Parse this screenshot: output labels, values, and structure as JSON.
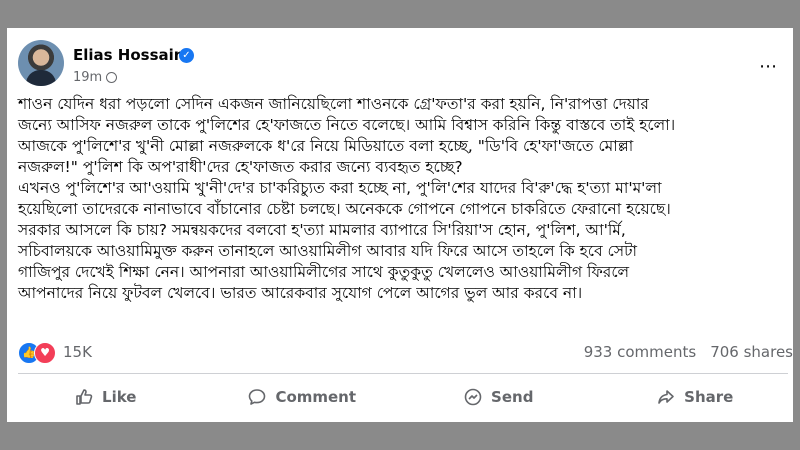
{
  "post": {
    "author": "Elias Hossain",
    "time": "19m",
    "more_icon": "⋯",
    "lines": [
      "শাওন যেদিন ধরা পড়লো সেদিন একজন জানিয়েছিলো শাওনকে গ্রে'ফতা'র করা হয়নি, নি'রাপত্তা দেয়ার",
      "জন্যে আসিফ নজরুল তাকে পু'লিশের হে'ফাজতে নিতে বলেছে। আমি বিশ্বাস করিনি কিন্তু বাস্তবে তাই হলো।",
      "আজকে পু'লিশে'র খু'নী মোল্লা নজরুলকে ধ'রে নিয়ে মিডিয়াতে বলা হচ্ছে, \"ডি'বি হে'ফা'জতে মোল্লা",
      "নজরুল!\" পু'লিশ কি অপ'রাধী'দের হে'ফাজত করার জন্যে ব্যবহৃত হচ্ছে?",
      "এখনও পু'লিশে'র আ'ওয়ামি খু'নী'দে'র চা'করিচ্যুত করা হচ্ছে না, পু'লি'শের যাদের বি'রু'দ্ধে হ'ত্যা মা'ম'লা",
      "হয়েছিলো তাদেরকে নানাভাবে বাঁচানোর চেষ্টা চলছে। অনেককে গোপনে গোপনে চাকরিতে ফেরানো হয়েছে।",
      "সরকার আসলে কি চায়? সমন্বয়কদের বলবো হ'ত্যা মামলার ব্যাপারে সি'রিয়া'স হোন, পু'লিশ, আ'র্মি,",
      "সচিবালয়কে আওয়ামিমুক্ত করুন তানাহলে আওয়ামিলীগ আবার যদি ফিরে আসে তাহলে কি হবে সেটা",
      "গাজিপুর দেখেই শিক্ষা নেন। আপনারা আওয়ামিলীগের সাথে কুতুকুতু খেললেও আওয়ামিলীগ ফিরলে",
      "আপনাদের নিয়ে ফুটবল খেলবে। ভারত আরেকবার সুযোগ পেলে আগের ভুল আর করবে না।"
    ]
  },
  "stats": {
    "reactions": "15K",
    "comments": "933 comments",
    "shares": "706 shares"
  },
  "actions": {
    "like": "Like",
    "comment": "Comment",
    "send": "Send",
    "share": "Share"
  },
  "colors": {
    "accent": "#1877f2",
    "love": "#f33e58",
    "muted": "#65676b"
  }
}
